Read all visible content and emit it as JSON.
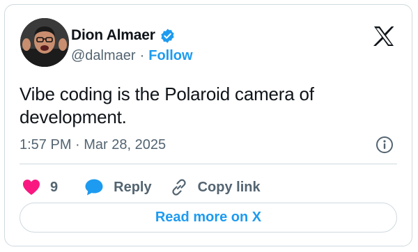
{
  "author": {
    "display_name": "Dion Almaer",
    "handle": "@dalmaer",
    "separator": "·",
    "follow_label": "Follow",
    "verified": true,
    "avatar_icon": "avatar-photo"
  },
  "tweet": {
    "text": "Vibe coding is the Polaroid camera of development.",
    "timestamp": "1:57 PM · Mar 28, 2025"
  },
  "actions": {
    "like_count": "9",
    "reply_label": "Reply",
    "copy_label": "Copy link"
  },
  "footer": {
    "read_more_label": "Read more on X"
  },
  "icons": {
    "brand": "x-logo-icon",
    "verified": "verified-badge-icon",
    "info": "info-icon",
    "like": "heart-icon",
    "reply": "speech-bubble-icon",
    "copy": "link-icon"
  },
  "colors": {
    "accent": "#1d9bf0",
    "like": "#f91880",
    "text": "#0f1419",
    "muted": "#536471",
    "border": "#cfd9de"
  }
}
